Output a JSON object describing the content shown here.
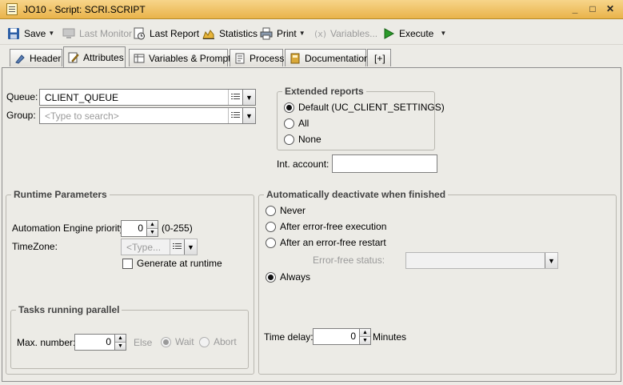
{
  "window": {
    "title": "JO10 - Script: SCRI.SCRIPT",
    "minimize": "_",
    "maximize": "□",
    "close": "✕"
  },
  "toolbar": {
    "save": "Save",
    "last_monitor": "Last Monitor",
    "last_report": "Last Report",
    "statistics": "Statistics",
    "print": "Print",
    "variables": "Variables...",
    "execute": "Execute"
  },
  "tabs": [
    {
      "label": "Header"
    },
    {
      "label": "Attributes"
    },
    {
      "label": "Variables & Prompts"
    },
    {
      "label": "Process"
    },
    {
      "label": "Documentation"
    },
    {
      "label": "[+]"
    }
  ],
  "queue": {
    "label": "Queue:",
    "value": "CLIENT_QUEUE"
  },
  "group": {
    "label": "Group:",
    "placeholder": "<Type to search>"
  },
  "extended_reports": {
    "title": "Extended reports",
    "options": [
      "Default (UC_CLIENT_SETTINGS)",
      "All",
      "None"
    ],
    "selected": 0
  },
  "int_account": {
    "label": "Int. account:",
    "value": ""
  },
  "runtime": {
    "title": "Runtime Parameters",
    "priority_label": "Automation Engine priority:",
    "priority_value": "0",
    "priority_range": "(0-255)",
    "timezone_label": "TimeZone:",
    "timezone_placeholder": "<Type...",
    "generate_label": "Generate at runtime"
  },
  "tasks_parallel": {
    "title": "Tasks running parallel",
    "max_label": "Max. number:",
    "max_value": "0",
    "else_label": "Else",
    "wait_label": "Wait",
    "abort_label": "Abort"
  },
  "auto_deactivate": {
    "title": "Automatically deactivate when finished",
    "options": [
      "Never",
      "After error-free execution",
      "After an error-free restart",
      "Always"
    ],
    "selected": 3,
    "error_free_status_label": "Error-free status:",
    "time_delay_label": "Time delay:",
    "time_delay_value": "0",
    "minutes_label": "Minutes"
  },
  "colors": {
    "titlebar": "#e9b34a",
    "execute_green": "#2a9a2a",
    "background": "#ecebe6"
  },
  "icons": {
    "save": "floppy-icon",
    "last_monitor": "monitor-icon",
    "last_report": "report-icon",
    "statistics": "chart-icon",
    "print": "printer-icon",
    "variables": "variables-icon",
    "execute": "play-icon"
  }
}
